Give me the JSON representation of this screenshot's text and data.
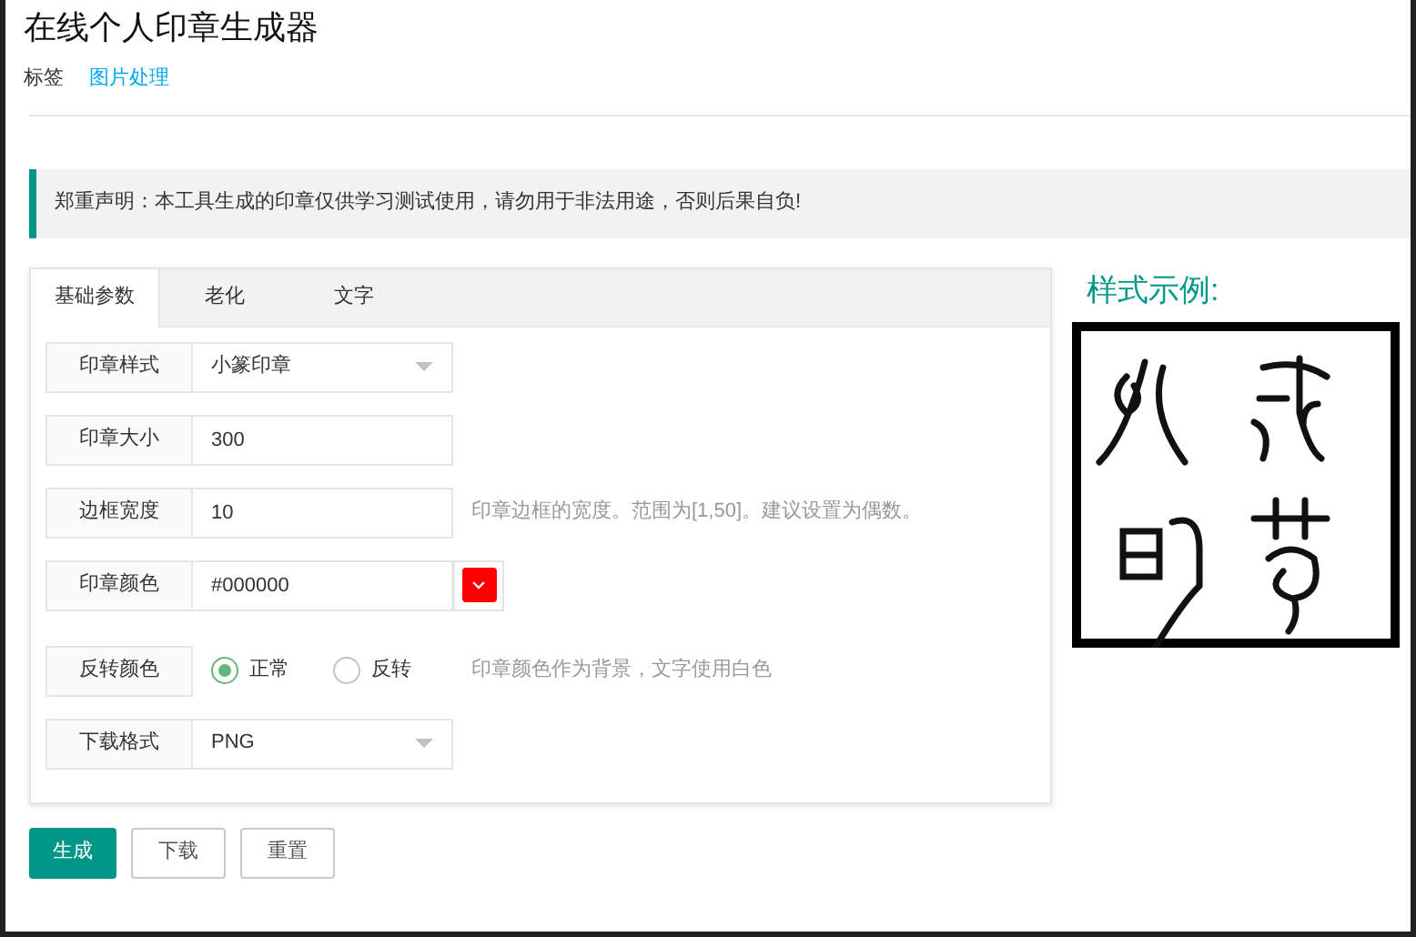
{
  "page": {
    "title": "在线个人印章生成器",
    "tags": [
      {
        "label": "标签",
        "kind": "label"
      },
      {
        "label": "图片处理",
        "kind": "link"
      }
    ]
  },
  "notice": "郑重声明：本工具生成的印章仅供学习测试使用，请勿用于非法用途，否则后果自负!",
  "tabs": [
    {
      "label": "基础参数",
      "selected": true
    },
    {
      "label": "老化",
      "selected": false
    },
    {
      "label": "文字",
      "selected": false
    }
  ],
  "form": [
    {
      "kind": "select",
      "label": "印章样式",
      "value": "小篆印章"
    },
    {
      "kind": "input",
      "label": "印章大小",
      "value": "300"
    },
    {
      "kind": "input",
      "label": "边框宽度",
      "value": "10",
      "hint": "印章边框的宽度。范围为[1,50]。建议设置为偶数。"
    },
    {
      "kind": "color",
      "label": "印章颜色",
      "value": "#000000",
      "color": "#ff0000"
    },
    {
      "kind": "radio",
      "label": "反转颜色",
      "options": [
        {
          "label": "正常",
          "selected": true
        },
        {
          "label": "反转",
          "selected": false
        }
      ],
      "hint": "印章颜色作为背景，文字使用白色"
    },
    {
      "kind": "select",
      "label": "下载格式",
      "value": "PNG"
    }
  ],
  "buttons": [
    {
      "label": "生成",
      "kind": "primary"
    },
    {
      "label": "下载",
      "kind": "default"
    },
    {
      "label": "重置",
      "kind": "default"
    }
  ],
  "sample": {
    "title": "样式示例:",
    "kind": "picture"
  }
}
